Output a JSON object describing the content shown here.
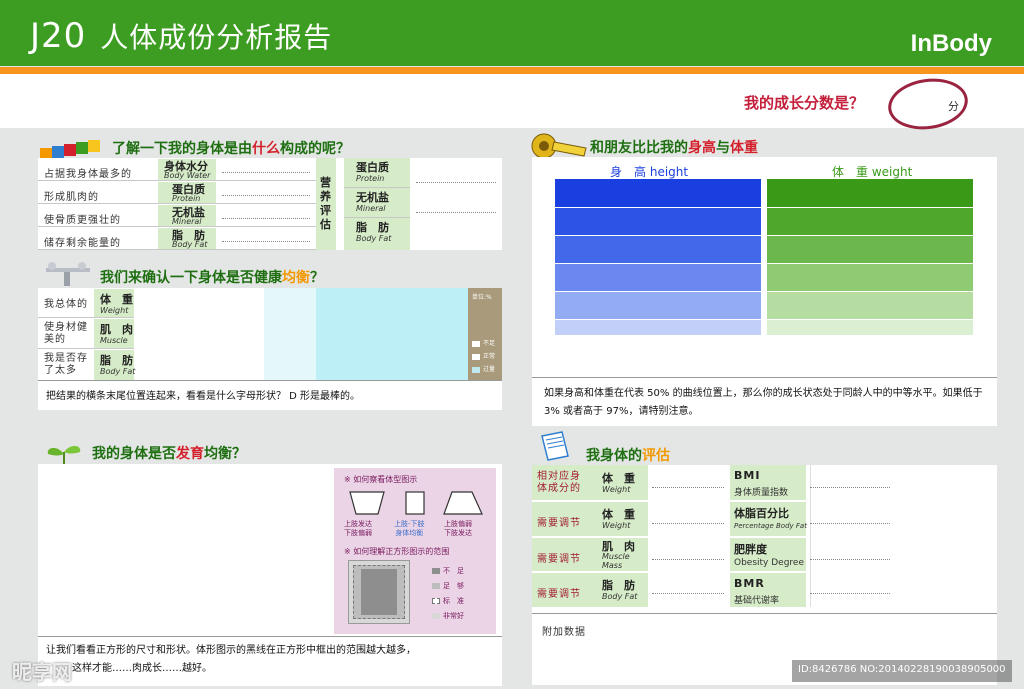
{
  "header": {
    "title_code": "J20",
    "title": "人体成份分析报告",
    "brand": "InBody"
  },
  "score": {
    "label": "我的成长分数是？",
    "unit": "分"
  },
  "composition": {
    "heading_pre": "了解一下我的身体是由",
    "heading_hl": "什么",
    "heading_post": "构成的呢？",
    "rows": [
      {
        "desc": "占据我身体最多的",
        "cn": "身体水分",
        "en": "Body Water"
      },
      {
        "desc": "形成肌肉的",
        "cn": "蛋白质",
        "en": "Protein"
      },
      {
        "desc": "使骨质更强壮的",
        "cn": "无机盐",
        "en": "Mineral"
      },
      {
        "desc": "储存剩余能量的",
        "cn": "脂　肪",
        "en": "Body Fat"
      }
    ],
    "nutrition_label": "营养评估",
    "nutrition_rows": [
      {
        "cn": "蛋白质",
        "en": "Protein"
      },
      {
        "cn": "无机盐",
        "en": "Mineral"
      },
      {
        "cn": "脂　肪",
        "en": "Body Fat"
      }
    ]
  },
  "balance": {
    "heading_pre": "我们来确认一下身体是否健康",
    "heading_hl": "均衡",
    "heading_post": "？",
    "unit": "单位:%",
    "rows": [
      {
        "desc": "我总体的",
        "cn": "体　重",
        "en": "Weight"
      },
      {
        "desc": "使身材健美的",
        "cn": "肌　肉",
        "en": "Muscle"
      },
      {
        "desc": "我是否存了太多",
        "cn": "脂　肪",
        "en": "Body Fat"
      }
    ],
    "legend": [
      {
        "label": "不足",
        "color": "#ffffff"
      },
      {
        "label": "正常",
        "color": "#ffffff"
      },
      {
        "label": "过量",
        "color": "#bfe9ee"
      }
    ],
    "note": "把结果的横条末尾位置连起来，看看是什么字母形状？ D 形是最棒的。",
    "colors": {
      "normal_zone": "#bdf0f6",
      "light_zone": "#e4f7f9",
      "legend_bg": "#a89a7a"
    }
  },
  "growth": {
    "heading_pre": "和朋友比比我的",
    "heading_hl": "身高",
    "heading_mid": "与",
    "heading_hl2": "体重",
    "height_label_cn": "身　高",
    "height_label_en": "height",
    "weight_label_cn": "体　重",
    "weight_label_en": "weight",
    "note": "如果身高和体重在代表 50% 的曲线位置上，那么你的成长状态处于同龄人中的中等水平。如果低于 3% 或者高于 97%，请特别注意。",
    "colors": {
      "blue": "#1a3fe0",
      "green": "#3a9a18"
    }
  },
  "development": {
    "heading_pre": "我的身体是否",
    "heading_hl": "发育",
    "heading_post": "均衡？",
    "howto_shape": "※ 如何察看体型图示",
    "shapes": [
      {
        "line1": "上肢发达",
        "line2": "下肢偏弱"
      },
      {
        "line1": "上肢-下肢",
        "line2": "身体均衡"
      },
      {
        "line1": "上肢偏弱",
        "line2": "下肢发达"
      }
    ],
    "howto_square": "※ 如何理解正方形图示的范围",
    "square_legend": [
      "不　足",
      "足　够",
      "标　准",
      "非常好"
    ],
    "note": "让我们看看正方形的尺寸和形状。体形图示的黑线在正方形中框出的范围越大越多，",
    "note2": "这样才能……肉成长……越好。"
  },
  "evaluation": {
    "heading_pre": "我身体的",
    "heading_hl": "评估",
    "left_rows": [
      {
        "desc": "相对应身体成分的",
        "cn": "体　重",
        "en": "Weight"
      },
      {
        "desc": "需要调节",
        "cn": "体　重",
        "en": "Weight"
      },
      {
        "desc": "需要调节",
        "cn": "肌　肉",
        "en": "Muscle Mass"
      },
      {
        "desc": "需要调节",
        "cn": "脂　肪",
        "en": "Body Fat"
      }
    ],
    "right_rows": [
      {
        "title": "BMI",
        "sub": "身体质量指数"
      },
      {
        "title": "体脂百分比",
        "sub": "Percentage Body Fat"
      },
      {
        "title": "肥胖度",
        "sub": "Obesity Degree"
      },
      {
        "title": "BMR",
        "sub": "基础代谢率"
      }
    ],
    "extra": "附加数据"
  },
  "watermark": {
    "left": "昵享网",
    "right": "ID:8426786 NO:20140228190038905000"
  }
}
